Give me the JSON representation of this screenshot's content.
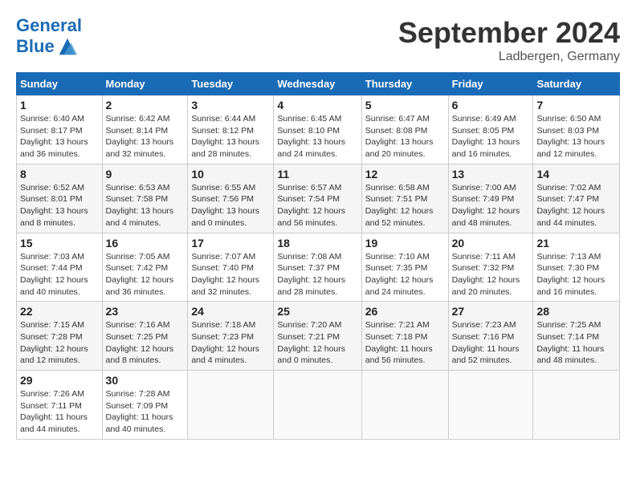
{
  "app": {
    "logo_line1": "General",
    "logo_line2": "Blue"
  },
  "header": {
    "month": "September 2024",
    "location": "Ladbergen, Germany"
  },
  "days_of_week": [
    "Sunday",
    "Monday",
    "Tuesday",
    "Wednesday",
    "Thursday",
    "Friday",
    "Saturday"
  ],
  "weeks": [
    [
      {
        "day": "1",
        "info": "Sunrise: 6:40 AM\nSunset: 8:17 PM\nDaylight: 13 hours and 36 minutes."
      },
      {
        "day": "2",
        "info": "Sunrise: 6:42 AM\nSunset: 8:14 PM\nDaylight: 13 hours and 32 minutes."
      },
      {
        "day": "3",
        "info": "Sunrise: 6:44 AM\nSunset: 8:12 PM\nDaylight: 13 hours and 28 minutes."
      },
      {
        "day": "4",
        "info": "Sunrise: 6:45 AM\nSunset: 8:10 PM\nDaylight: 13 hours and 24 minutes."
      },
      {
        "day": "5",
        "info": "Sunrise: 6:47 AM\nSunset: 8:08 PM\nDaylight: 13 hours and 20 minutes."
      },
      {
        "day": "6",
        "info": "Sunrise: 6:49 AM\nSunset: 8:05 PM\nDaylight: 13 hours and 16 minutes."
      },
      {
        "day": "7",
        "info": "Sunrise: 6:50 AM\nSunset: 8:03 PM\nDaylight: 13 hours and 12 minutes."
      }
    ],
    [
      {
        "day": "8",
        "info": "Sunrise: 6:52 AM\nSunset: 8:01 PM\nDaylight: 13 hours and 8 minutes."
      },
      {
        "day": "9",
        "info": "Sunrise: 6:53 AM\nSunset: 7:58 PM\nDaylight: 13 hours and 4 minutes."
      },
      {
        "day": "10",
        "info": "Sunrise: 6:55 AM\nSunset: 7:56 PM\nDaylight: 13 hours and 0 minutes."
      },
      {
        "day": "11",
        "info": "Sunrise: 6:57 AM\nSunset: 7:54 PM\nDaylight: 12 hours and 56 minutes."
      },
      {
        "day": "12",
        "info": "Sunrise: 6:58 AM\nSunset: 7:51 PM\nDaylight: 12 hours and 52 minutes."
      },
      {
        "day": "13",
        "info": "Sunrise: 7:00 AM\nSunset: 7:49 PM\nDaylight: 12 hours and 48 minutes."
      },
      {
        "day": "14",
        "info": "Sunrise: 7:02 AM\nSunset: 7:47 PM\nDaylight: 12 hours and 44 minutes."
      }
    ],
    [
      {
        "day": "15",
        "info": "Sunrise: 7:03 AM\nSunset: 7:44 PM\nDaylight: 12 hours and 40 minutes."
      },
      {
        "day": "16",
        "info": "Sunrise: 7:05 AM\nSunset: 7:42 PM\nDaylight: 12 hours and 36 minutes."
      },
      {
        "day": "17",
        "info": "Sunrise: 7:07 AM\nSunset: 7:40 PM\nDaylight: 12 hours and 32 minutes."
      },
      {
        "day": "18",
        "info": "Sunrise: 7:08 AM\nSunset: 7:37 PM\nDaylight: 12 hours and 28 minutes."
      },
      {
        "day": "19",
        "info": "Sunrise: 7:10 AM\nSunset: 7:35 PM\nDaylight: 12 hours and 24 minutes."
      },
      {
        "day": "20",
        "info": "Sunrise: 7:11 AM\nSunset: 7:32 PM\nDaylight: 12 hours and 20 minutes."
      },
      {
        "day": "21",
        "info": "Sunrise: 7:13 AM\nSunset: 7:30 PM\nDaylight: 12 hours and 16 minutes."
      }
    ],
    [
      {
        "day": "22",
        "info": "Sunrise: 7:15 AM\nSunset: 7:28 PM\nDaylight: 12 hours and 12 minutes."
      },
      {
        "day": "23",
        "info": "Sunrise: 7:16 AM\nSunset: 7:25 PM\nDaylight: 12 hours and 8 minutes."
      },
      {
        "day": "24",
        "info": "Sunrise: 7:18 AM\nSunset: 7:23 PM\nDaylight: 12 hours and 4 minutes."
      },
      {
        "day": "25",
        "info": "Sunrise: 7:20 AM\nSunset: 7:21 PM\nDaylight: 12 hours and 0 minutes."
      },
      {
        "day": "26",
        "info": "Sunrise: 7:21 AM\nSunset: 7:18 PM\nDaylight: 11 hours and 56 minutes."
      },
      {
        "day": "27",
        "info": "Sunrise: 7:23 AM\nSunset: 7:16 PM\nDaylight: 11 hours and 52 minutes."
      },
      {
        "day": "28",
        "info": "Sunrise: 7:25 AM\nSunset: 7:14 PM\nDaylight: 11 hours and 48 minutes."
      }
    ],
    [
      {
        "day": "29",
        "info": "Sunrise: 7:26 AM\nSunset: 7:11 PM\nDaylight: 11 hours and 44 minutes."
      },
      {
        "day": "30",
        "info": "Sunrise: 7:28 AM\nSunset: 7:09 PM\nDaylight: 11 hours and 40 minutes."
      },
      {
        "day": "",
        "info": ""
      },
      {
        "day": "",
        "info": ""
      },
      {
        "day": "",
        "info": ""
      },
      {
        "day": "",
        "info": ""
      },
      {
        "day": "",
        "info": ""
      }
    ]
  ]
}
